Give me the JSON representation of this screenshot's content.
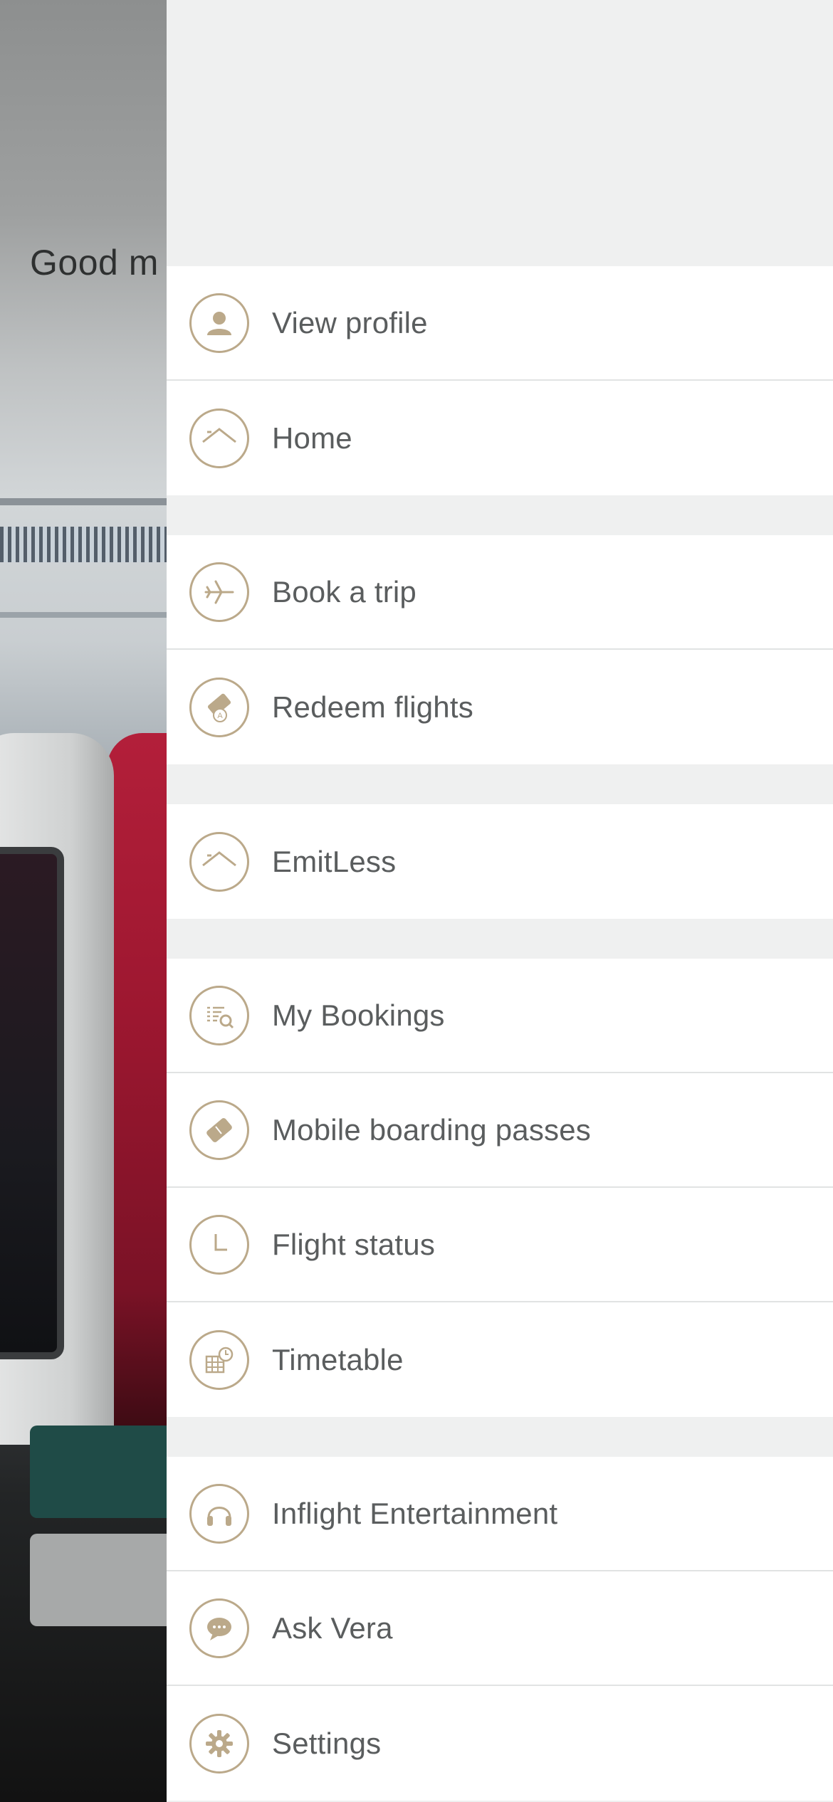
{
  "background": {
    "greeting": "Good m"
  },
  "drawer": {
    "accent_color": "#bba98a",
    "groups": [
      {
        "items": [
          {
            "label": "View profile",
            "icon": "profile-icon"
          },
          {
            "label": "Home",
            "icon": "home-icon"
          }
        ]
      },
      {
        "items": [
          {
            "label": "Book a trip",
            "icon": "plane-icon"
          },
          {
            "label": "Redeem flights",
            "icon": "redeem-ticket-icon"
          }
        ]
      },
      {
        "items": [
          {
            "label": "EmitLess",
            "icon": "emitless-icon"
          }
        ]
      },
      {
        "items": [
          {
            "label": "My Bookings",
            "icon": "bookings-search-icon"
          },
          {
            "label": "Mobile boarding passes",
            "icon": "boarding-pass-icon"
          },
          {
            "label": "Flight status",
            "icon": "clock-icon"
          },
          {
            "label": "Timetable",
            "icon": "timetable-icon"
          }
        ]
      },
      {
        "items": [
          {
            "label": "Inflight Entertainment",
            "icon": "headphones-icon"
          },
          {
            "label": "Ask Vera",
            "icon": "chat-bubble-icon"
          },
          {
            "label": "Settings",
            "icon": "gear-icon"
          }
        ]
      }
    ]
  }
}
